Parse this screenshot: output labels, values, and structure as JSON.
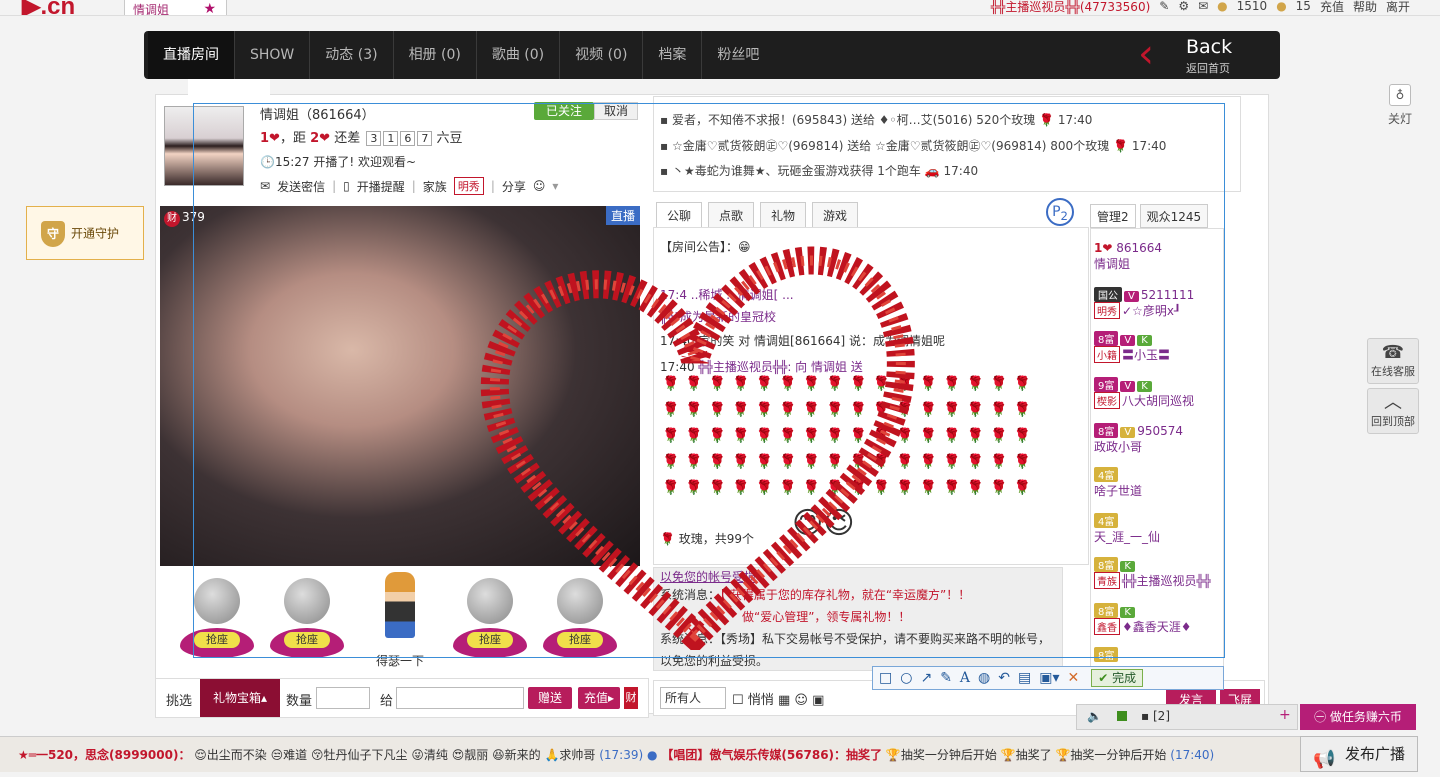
{
  "topbar": {
    "logo": "▶.cn",
    "tab_label": "情调姐",
    "username": "╬╬主播巡视员╬╬(47733560)",
    "coins_1": "1510",
    "coins_2": "15",
    "recharge": "充值",
    "help": "帮助",
    "leave": "离开"
  },
  "nav": {
    "items": [
      "直播房间",
      "SHOW",
      "动态 (3)",
      "相册 (0)",
      "歌曲 (0)",
      "视频 (0)",
      "档案",
      "粉丝吧"
    ],
    "back_label": "Back",
    "back_sub": "返回首页"
  },
  "guard_button": "开通守护",
  "right_rail": {
    "lamp": "关灯",
    "service": "在线客服",
    "top": "回到顶部"
  },
  "host": {
    "name": "情调姐（861664）",
    "follow": "已关注",
    "cancel": "取消",
    "rank_text": "，距",
    "rank_need": "还差",
    "rank_digits": [
      "3",
      "1",
      "6",
      "7"
    ],
    "rank_unit": "六豆",
    "rank_1": "1",
    "rank_2": "2",
    "time_line": "15:27 开播了! 欢迎观看~",
    "send_msg": "发送密信",
    "remind": "开播提醒",
    "family": "家族",
    "family_badge": "明秀",
    "share": "分享"
  },
  "video": {
    "live_badge": "直播",
    "count": "379",
    "cai": "财"
  },
  "seats": [
    {
      "label": "抢座"
    },
    {
      "label": "抢座"
    },
    {
      "label": "得瑟一下"
    },
    {
      "label": "抢座"
    },
    {
      "label": "抢座"
    }
  ],
  "gift_bar": {
    "pick": "挑选",
    "treasure": "礼物宝箱",
    "qty_label": "数量",
    "to_label": "给",
    "send": "赠送",
    "charge": "充值",
    "cai": "财"
  },
  "feed": [
    "爱者，不知倦不求报！(695843) 送给 ♦◦柯…艾(5016) 520个玫瑰",
    "☆金庸♡贰货筱朗㊣♡(969814) 送给 ☆金庸♡贰货筱朗㊣♡(969814) 800个玫瑰",
    "丶★毒蛇为谁舞★、玩砸金蛋游戏获得 1个跑车"
  ],
  "feed_times": [
    "17:40",
    "17:40",
    "17:40"
  ],
  "chat_tabs": [
    "公聊",
    "点歌",
    "礼物",
    "游戏"
  ],
  "chat": {
    "notice": "【房间公告】：",
    "line1": "17:4 ..稀城 ...情调姐[ ...",
    "line2": "╬╬\"成为最新的皇冠校",
    "line3_time": "17:40",
    "line3": "家的笑 对 情调姐[861664] 说：成为调情姐呢",
    "line4_time": "17:40",
    "line4": "╬╬主播巡视员╬╬: 向 情调姐 送",
    "rose_total": "玫瑰，共99个"
  },
  "system": {
    "line1": "以免您的帐号受损",
    "line2_label": "系统消息：",
    "line2": "【 获得属于您的库存礼物，就在“幸运魔方”！！",
    "line3": "做“爱心管理”，领专属礼物！！",
    "line4": "系统消息：【秀场】私下交易帐号不受保护，请不要购买来路不明的帐号，",
    "line5": "以免您的利益受损。"
  },
  "user_tabs": [
    "管理2",
    "观众1245"
  ],
  "users": [
    {
      "lv": "1",
      "id": "861664",
      "name": "情调姐"
    },
    {
      "lv": "国公",
      "id": "5211111",
      "tag": "明秀",
      "name": "✓☆彦明x┚"
    },
    {
      "lv": "8富",
      "tag": "小籍",
      "name": "〓小玉〓"
    },
    {
      "lv": "9富",
      "tag": "楔影",
      "name": "八大胡同巡视"
    },
    {
      "lv": "8富",
      "id": "950574",
      "name": "政政小哥"
    },
    {
      "lv": "4富",
      "name": "啥子世道"
    },
    {
      "lv": "4富",
      "name": "天_涯_一_仙"
    },
    {
      "lv": "8富",
      "tag": "青族",
      "name": "╬╬主播巡视员╬╬"
    },
    {
      "lv": "8富",
      "tag": "鑫香",
      "name": "♦鑫香天涯♦"
    },
    {
      "lv": "8富",
      "name": ""
    }
  ],
  "chat_controls": {
    "target": "所有人",
    "whisper": "悄悄",
    "send": "发言",
    "fly": "飞屏"
  },
  "screenshot_tool": {
    "done": "完成"
  },
  "mini_panel": {
    "count": "[2]"
  },
  "task_button": "做任务赚六币",
  "marquee": {
    "part1": "★═一520，思念(8999000)：",
    "part2": "出尘而不染",
    "part3": "难道",
    "part4": "牡丹仙子下凡尘",
    "part5": "清纯",
    "part6": "靓丽",
    "part7": "新来的",
    "part8": "求帅哥",
    "time1": "(17:39)",
    "part9": "【唱团】傲气娱乐传媒(56786)：抽奖了",
    "part10": "抽奖一分钟后开始",
    "part11": "抽奖了",
    "part12": "抽奖一分钟后开始",
    "time2": "(17:40)"
  },
  "broadcast": "发布广播",
  "colors": {
    "brand": "#c2162c",
    "accent": "#b71d5c",
    "nav_bg": "#1e1e1e",
    "selection": "#3b8ed8"
  }
}
